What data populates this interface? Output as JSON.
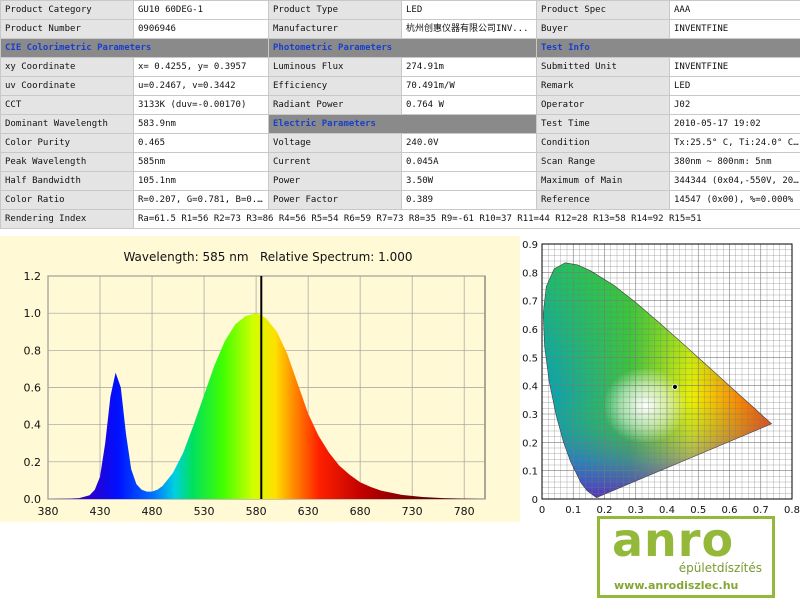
{
  "report": {
    "rows": [
      [
        {
          "t": "Product Category",
          "k": "lab"
        },
        {
          "t": "GU10 60DEG-1",
          "k": "val"
        },
        {
          "t": "Product Type",
          "k": "lab"
        },
        {
          "t": "LED",
          "k": "val"
        },
        {
          "t": "Product Spec",
          "k": "lab"
        },
        {
          "t": "AAA",
          "k": "val"
        }
      ],
      [
        {
          "t": "Product Number",
          "k": "lab"
        },
        {
          "t": "0906946",
          "k": "val"
        },
        {
          "t": "Manufacturer",
          "k": "lab"
        },
        {
          "t": "杭州创惠仪器有限公司INV...",
          "k": "val"
        },
        {
          "t": "Buyer",
          "k": "lab"
        },
        {
          "t": "INVENTFINE",
          "k": "val"
        }
      ],
      [
        {
          "t": "CIE Colorimetric Parameters",
          "k": "sec",
          "c": 2
        },
        {
          "t": "Photometric Parameters",
          "k": "sec",
          "c": 2
        },
        {
          "t": "Test Info",
          "k": "sec",
          "c": 2
        }
      ],
      [
        {
          "t": "xy Coordinate",
          "k": "lab"
        },
        {
          "t": "x= 0.4255, y= 0.3957",
          "k": "val"
        },
        {
          "t": "Luminous Flux",
          "k": "lab"
        },
        {
          "t": "274.91m",
          "k": "val"
        },
        {
          "t": "Submitted Unit",
          "k": "lab"
        },
        {
          "t": "INVENTFINE",
          "k": "val"
        }
      ],
      [
        {
          "t": "uv Coordinate",
          "k": "lab"
        },
        {
          "t": "u=0.2467, v=0.3442",
          "k": "val"
        },
        {
          "t": "Efficiency",
          "k": "lab"
        },
        {
          "t": "70.491m/W",
          "k": "val"
        },
        {
          "t": "Remark",
          "k": "lab"
        },
        {
          "t": "LED",
          "k": "val"
        }
      ],
      [
        {
          "t": "CCT",
          "k": "lab"
        },
        {
          "t": "3133K (duv=-0.00170)",
          "k": "val"
        },
        {
          "t": "Radiant Power",
          "k": "lab"
        },
        {
          "t": "0.764 W",
          "k": "val"
        },
        {
          "t": "Operator",
          "k": "lab"
        },
        {
          "t": "J02",
          "k": "val"
        }
      ],
      [
        {
          "t": "Dominant Wavelength",
          "k": "lab"
        },
        {
          "t": "583.9nm",
          "k": "val"
        },
        {
          "t": "Electric Parameters",
          "k": "sec",
          "c": 2
        },
        {
          "t": "Test Time",
          "k": "lab"
        },
        {
          "t": "2010-05-17 19:02",
          "k": "val"
        }
      ],
      [
        {
          "t": "Color Purity",
          "k": "lab"
        },
        {
          "t": "0.465",
          "k": "val"
        },
        {
          "t": "Voltage",
          "k": "lab"
        },
        {
          "t": "240.0V",
          "k": "val"
        },
        {
          "t": "Condition",
          "k": "lab"
        },
        {
          "t": "Tx:25.5° C, Ti:24.0° C;...",
          "k": "val"
        }
      ],
      [
        {
          "t": "Peak Wavelength",
          "k": "lab"
        },
        {
          "t": "585nm",
          "k": "val"
        },
        {
          "t": "Current",
          "k": "lab"
        },
        {
          "t": "0.045A",
          "k": "val"
        },
        {
          "t": "Scan Range",
          "k": "lab"
        },
        {
          "t": "380nm ~ 800nm: 5nm",
          "k": "val"
        }
      ],
      [
        {
          "t": "Half Bandwidth",
          "k": "lab"
        },
        {
          "t": "105.1nm",
          "k": "val"
        },
        {
          "t": "Power",
          "k": "lab"
        },
        {
          "t": "3.50W",
          "k": "val"
        },
        {
          "t": "Maximum of Main",
          "k": "lab"
        },
        {
          "t": "344344 (0x04,-550V, 204)",
          "k": "val"
        }
      ],
      [
        {
          "t": "Color Ratio",
          "k": "lab"
        },
        {
          "t": "R=0.207, G=0.781, B=0.012",
          "k": "val"
        },
        {
          "t": "Power Factor",
          "k": "lab"
        },
        {
          "t": "0.389",
          "k": "val"
        },
        {
          "t": "Reference",
          "k": "lab"
        },
        {
          "t": "14547 (0x00), %=0.000%",
          "k": "val"
        }
      ],
      [
        {
          "t": "Rendering Index",
          "k": "lab"
        },
        {
          "t": "Ra=61.5  R1=56 R2=73 R3=86 R4=56 R5=54 R6=59 R7=73 R8=35 R9=-61 R10=37 R11=44 R12=28 R13=58 R14=92 R15=51",
          "k": "val",
          "c": 5
        }
      ]
    ]
  },
  "chart_data": [
    {
      "type": "area",
      "title": "Wavelength: 585 nm   Relative Spectrum: 1.000",
      "xlabel": "",
      "ylabel": "",
      "xlim": [
        380,
        800
      ],
      "ylim": [
        0,
        1.2
      ],
      "x_ticks": [
        380,
        430,
        480,
        530,
        580,
        630,
        680,
        730,
        780
      ],
      "y_ticks": [
        0.0,
        0.2,
        0.4,
        0.6,
        0.8,
        1.0,
        1.2
      ],
      "grid": true,
      "marker_wavelength": 585,
      "x": [
        380,
        400,
        410,
        420,
        425,
        430,
        435,
        440,
        445,
        450,
        455,
        460,
        465,
        470,
        475,
        480,
        485,
        490,
        500,
        510,
        520,
        530,
        540,
        550,
        560,
        570,
        580,
        585,
        590,
        600,
        610,
        620,
        630,
        640,
        650,
        660,
        670,
        680,
        690,
        700,
        720,
        740,
        760,
        780,
        800
      ],
      "y": [
        0,
        0.002,
        0.005,
        0.02,
        0.05,
        0.12,
        0.3,
        0.55,
        0.68,
        0.6,
        0.35,
        0.16,
        0.08,
        0.05,
        0.04,
        0.04,
        0.05,
        0.07,
        0.14,
        0.25,
        0.4,
        0.56,
        0.72,
        0.85,
        0.94,
        0.985,
        1.0,
        0.99,
        0.97,
        0.9,
        0.78,
        0.62,
        0.46,
        0.34,
        0.25,
        0.18,
        0.13,
        0.09,
        0.065,
        0.045,
        0.022,
        0.011,
        0.005,
        0.002,
        0.0
      ]
    },
    {
      "type": "scatter",
      "xlim": [
        0,
        0.8
      ],
      "ylim": [
        0,
        0.9
      ],
      "x_ticks": [
        0,
        0.1,
        0.2,
        0.3,
        0.4,
        0.5,
        0.6,
        0.7,
        0.8
      ],
      "y_ticks": [
        0,
        0.1,
        0.2,
        0.3,
        0.4,
        0.5,
        0.6,
        0.7,
        0.8,
        0.9
      ],
      "x_tick_labels": [
        "0",
        "0.1",
        "0.2",
        "0.3",
        "0.4",
        "0.5",
        "0.6",
        "0.7",
        "0.8"
      ],
      "y_tick_labels": [
        "0",
        "0.1",
        "0.2",
        "0.3",
        "0.4",
        "0.5",
        "0.6",
        "0.7",
        "0.8",
        "0.9"
      ],
      "grid": true,
      "points": [
        {
          "x": 0.4255,
          "y": 0.3957
        }
      ],
      "locus": [
        [
          0.1741,
          0.005
        ],
        [
          0.144,
          0.0297
        ],
        [
          0.1241,
          0.0578
        ],
        [
          0.0913,
          0.1327
        ],
        [
          0.0687,
          0.2007
        ],
        [
          0.0454,
          0.295
        ],
        [
          0.0235,
          0.4127
        ],
        [
          0.0082,
          0.5384
        ],
        [
          0.0039,
          0.6548
        ],
        [
          0.0139,
          0.7502
        ],
        [
          0.0389,
          0.812
        ],
        [
          0.0743,
          0.8338
        ],
        [
          0.1142,
          0.8262
        ],
        [
          0.1547,
          0.8059
        ],
        [
          0.2296,
          0.7543
        ],
        [
          0.3016,
          0.6923
        ],
        [
          0.3731,
          0.6245
        ],
        [
          0.4441,
          0.5547
        ],
        [
          0.5125,
          0.4866
        ],
        [
          0.5752,
          0.4242
        ],
        [
          0.627,
          0.3725
        ],
        [
          0.6658,
          0.334
        ],
        [
          0.6915,
          0.3083
        ],
        [
          0.7079,
          0.292
        ],
        [
          0.7347,
          0.2653
        ]
      ]
    }
  ],
  "logo": {
    "word": "anro",
    "tagline": "épületdíszítés",
    "url": "www.anrodiszlec.hu"
  }
}
